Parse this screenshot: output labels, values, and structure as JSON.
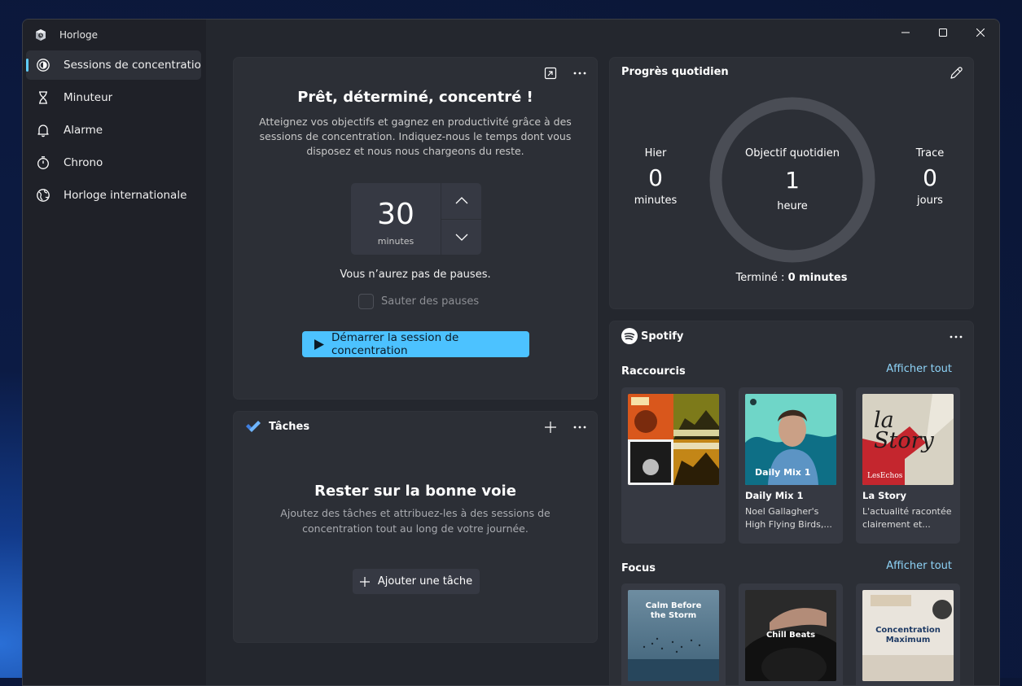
{
  "app": {
    "title": "Horloge"
  },
  "sidebar": {
    "items": [
      {
        "label": "Sessions de concentratio",
        "icon": "focus-icon",
        "active": true
      },
      {
        "label": "Minuteur",
        "icon": "hourglass-icon"
      },
      {
        "label": "Alarme",
        "icon": "bell-icon"
      },
      {
        "label": "Chrono",
        "icon": "stopwatch-icon"
      },
      {
        "label": "Horloge internationale",
        "icon": "globe-icon"
      }
    ]
  },
  "focus": {
    "title": "Prêt, déterminé, concentré !",
    "description": "Atteignez vos objectifs et gagnez en productivité grâce à des sessions de concentration. Indiquez-nous le temps dont vous disposez et nous nous chargeons du reste.",
    "duration_value": "30",
    "duration_unit": "minutes",
    "breaks_text": "Vous n’aurez pas de pauses.",
    "skip_breaks_label": "Sauter des pauses",
    "start_button": "Démarrer la session de concentration"
  },
  "tasks": {
    "header": "Tâches",
    "title": "Rester sur la bonne voie",
    "description": "Ajoutez des tâches et attribuez-les à des sessions de concentration tout au long de votre journée.",
    "add_button": "Ajouter une tâche"
  },
  "progress": {
    "header": "Progrès quotidien",
    "yesterday": {
      "label": "Hier",
      "value": "0",
      "unit": "minutes"
    },
    "goal": {
      "label": "Objectif quotidien",
      "value": "1",
      "unit": "heure"
    },
    "streak": {
      "label": "Trace",
      "value": "0",
      "unit": "jours"
    },
    "completed_label": "Terminé :",
    "completed_value": "0 minutes",
    "goal_fraction": 0
  },
  "spotify": {
    "brand": "Spotify",
    "shortcuts": {
      "title": "Raccourcis",
      "show_all": "Afficher tout",
      "items": [
        {
          "title": "",
          "subtitle": ""
        },
        {
          "title": "Daily Mix 1",
          "subtitle": "Noel Gallagher's High Flying Birds,...",
          "cover_text": "Daily Mix 1"
        },
        {
          "title": "La Story",
          "subtitle": "L'actualité racontée clairement et...",
          "cover_text": "la Story",
          "cover_sub": "LesEchos"
        }
      ]
    },
    "focus": {
      "title": "Focus",
      "show_all": "Afficher tout",
      "items": [
        {
          "cover_text": "Calm Before the Storm"
        },
        {
          "cover_text": "Chill Beats"
        },
        {
          "cover_text": "Concentration Maximum"
        }
      ]
    }
  },
  "colors": {
    "accent": "#4cc2ff",
    "link": "#8ed3f7",
    "spotify_green": "#1db954"
  }
}
